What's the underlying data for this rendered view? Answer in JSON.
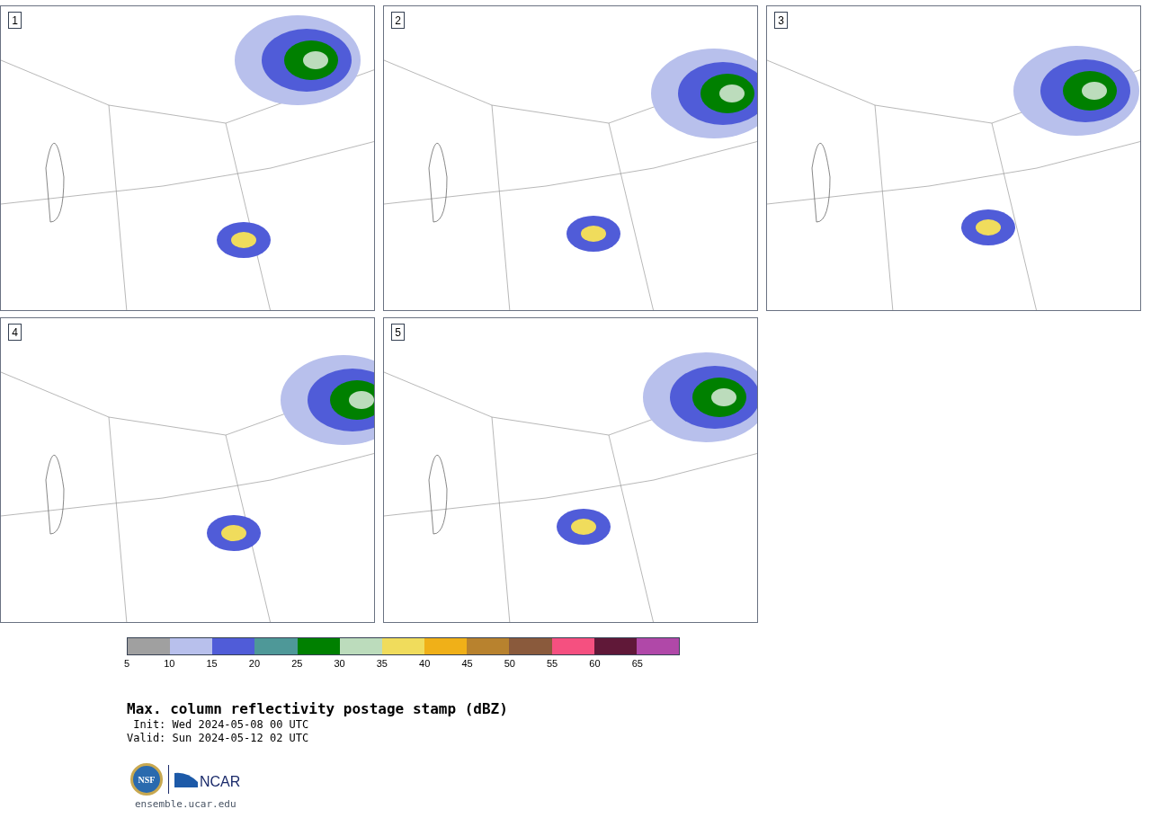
{
  "panels": [
    {
      "label": "1"
    },
    {
      "label": "2"
    },
    {
      "label": "3"
    },
    {
      "label": "4"
    },
    {
      "label": "5"
    }
  ],
  "colorbar": [
    {
      "label": "5",
      "color": "#a0a0a0"
    },
    {
      "label": "10",
      "color": "#b8c0ec"
    },
    {
      "label": "15",
      "color": "#505cd8"
    },
    {
      "label": "20",
      "color": "#4e9898"
    },
    {
      "label": "25",
      "color": "#008000"
    },
    {
      "label": "30",
      "color": "#bcdcbc"
    },
    {
      "label": "35",
      "color": "#f0dc5c"
    },
    {
      "label": "40",
      "color": "#f0b018"
    },
    {
      "label": "45",
      "color": "#b8822e"
    },
    {
      "label": "50",
      "color": "#8a5a3c"
    },
    {
      "label": "55",
      "color": "#f55080"
    },
    {
      "label": "60",
      "color": "#601838"
    },
    {
      "label": "65",
      "color": "#b048a8"
    }
  ],
  "title": "Max. column reflectivity postage stamp (dBZ)",
  "init": " Init: Wed 2024-05-08 00 UTC",
  "valid": "Valid: Sun 2024-05-12 02 UTC",
  "logo": {
    "nsf": "NSF",
    "ncar": "NCAR"
  },
  "url": "ensemble.ucar.edu"
}
